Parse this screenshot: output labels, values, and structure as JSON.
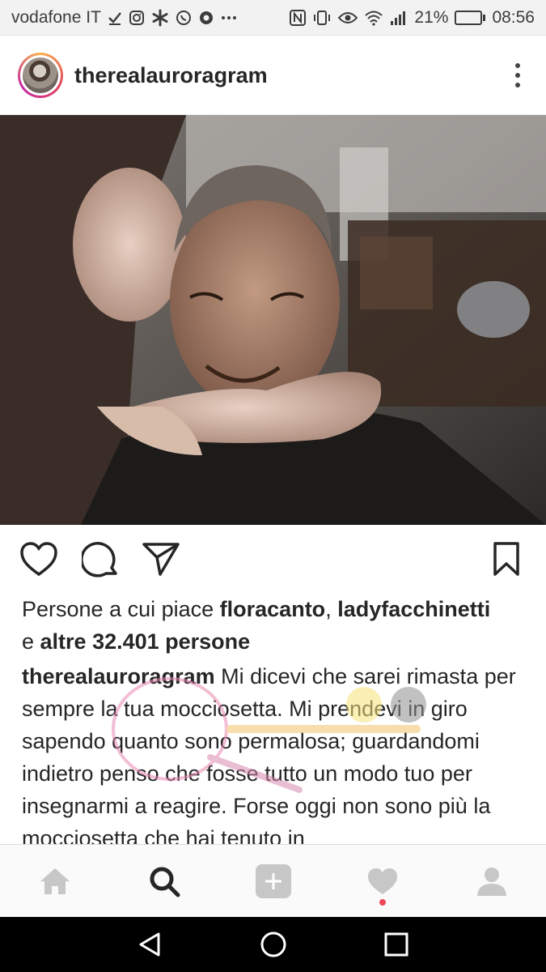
{
  "status_bar": {
    "carrier": "vodafone IT",
    "battery_percent": "21%",
    "battery_level": 0.21,
    "time": "08:56",
    "icons": [
      "check-icon",
      "instagram-icon",
      "asterisk-icon",
      "whatsapp-icon",
      "chrome-icon",
      "more-dots-icon",
      "nfc-icon",
      "vibrate-icon",
      "eye-icon",
      "wifi-icon",
      "signal-icon",
      "battery-icon"
    ]
  },
  "post": {
    "username": "therealauroragram",
    "photo_description_icon": "photo",
    "likes": {
      "prefix": "Persone a cui piace ",
      "user1": "floracanto",
      "sep": ", ",
      "user2": "ladyfacchinetti",
      "and": "e ",
      "others": "altre 32.401 persone"
    },
    "caption": {
      "username": "therealauroragram",
      "text": " Mi dicevi che sarei rimasta per sempre la tua mocciosetta. Mi prendevi in giro sapendo quanto sono permalosa; guardandomi indietro penso che fosse tutto un modo tuo per insegnarmi a reagire. Forse oggi non sono più la mocciosetta che hai tenuto in"
    }
  },
  "colors": {
    "accent_notification": "#ed4956",
    "icon_dark": "#262626",
    "nav_icon_inactive": "#c7c7c7"
  }
}
